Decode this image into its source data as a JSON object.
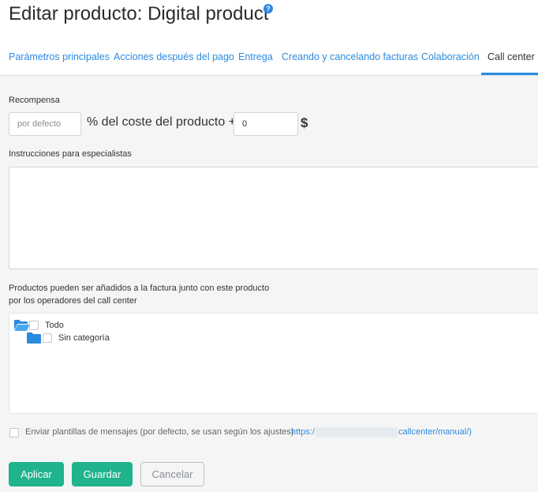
{
  "header": {
    "title": "Editar producto: Digital product",
    "help_icon_text": "?"
  },
  "tabs": [
    {
      "label": "Parámetros principales"
    },
    {
      "label": "Acciones después del pago"
    },
    {
      "label": "Entrega"
    },
    {
      "label": "Creando y cancelando facturas"
    },
    {
      "label": "Colaboración"
    },
    {
      "label": "Call center",
      "active": true
    }
  ],
  "reward": {
    "label": "Recompensa",
    "percent_placeholder": "por defecto",
    "percent_text": "% del coste del producto +",
    "amount_value": "0",
    "currency_symbol": "$"
  },
  "instructions": {
    "label": "Instrucciones para especialistas",
    "value": ""
  },
  "products": {
    "label_line1": "Productos pueden ser añadidos a la factura junto con este producto",
    "label_line2": "por los operadores del call center",
    "tree": [
      {
        "label": "Todo",
        "icon": "folder-open-icon",
        "checked": false
      },
      {
        "label": "Sin categoría",
        "icon": "folder-icon",
        "checked": false
      }
    ]
  },
  "send_templates": {
    "text": "Enviar plantillas de mensajes (por defecto, se usan según los ajustes)",
    "link_prefix": "https:/",
    "link_suffix": "callcenter/manual/)",
    "checked": false
  },
  "buttons": {
    "apply": "Aplicar",
    "save": "Guardar",
    "cancel": "Cancelar"
  },
  "colors": {
    "accent": "#2b8ae0",
    "primary_button": "#1fb38e",
    "content_bg": "#f5f5f6"
  }
}
